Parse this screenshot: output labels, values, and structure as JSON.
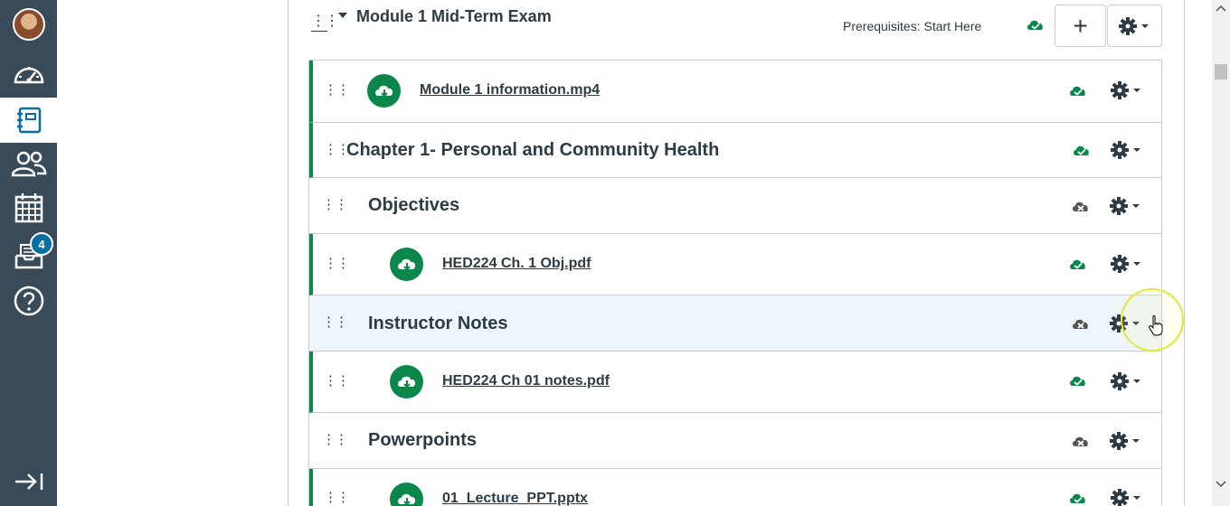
{
  "global_nav": {
    "items": [
      {
        "name": "account",
        "icon": "avatar"
      },
      {
        "name": "dashboard",
        "icon": "speedometer-icon"
      },
      {
        "name": "courses",
        "icon": "notebook-icon",
        "active": true
      },
      {
        "name": "groups",
        "icon": "people-icon"
      },
      {
        "name": "calendar",
        "icon": "calendar-icon"
      },
      {
        "name": "inbox",
        "icon": "inbox-icon",
        "badge": "4"
      },
      {
        "name": "help",
        "icon": "help-icon"
      }
    ],
    "collapse_icon": "collapse-arrow-icon"
  },
  "module": {
    "title": "Module 1 Mid-Term Exam",
    "prerequisites": "Prerequisites: Start Here",
    "add_button": "+",
    "published": true
  },
  "items": [
    {
      "type": "file",
      "title": "Module 1 information.mp4",
      "indent": 0,
      "published": true
    },
    {
      "type": "header",
      "title": "Chapter 1- Personal and Community Health",
      "indent": 0,
      "published": true
    },
    {
      "type": "header",
      "title": "Objectives",
      "indent": 1,
      "published": false
    },
    {
      "type": "file",
      "title": "HED224 Ch. 1 Obj.pdf",
      "indent": 1,
      "published": true
    },
    {
      "type": "header",
      "title": "Instructor Notes",
      "indent": 1,
      "published": false
    },
    {
      "type": "file",
      "title": "HED224 Ch 01 notes.pdf",
      "indent": 1,
      "published": true
    },
    {
      "type": "header",
      "title": "Powerpoints",
      "indent": 1,
      "published": false
    },
    {
      "type": "file",
      "title": "01_Lecture_PPT.pptx",
      "indent": 1,
      "published": true
    }
  ],
  "colors": {
    "nav_bg": "#394b58",
    "published_green": "#0b874b",
    "unpublished_gray": "#555555",
    "badge_blue": "#0770a3",
    "hover_row": "#eef5fb"
  }
}
